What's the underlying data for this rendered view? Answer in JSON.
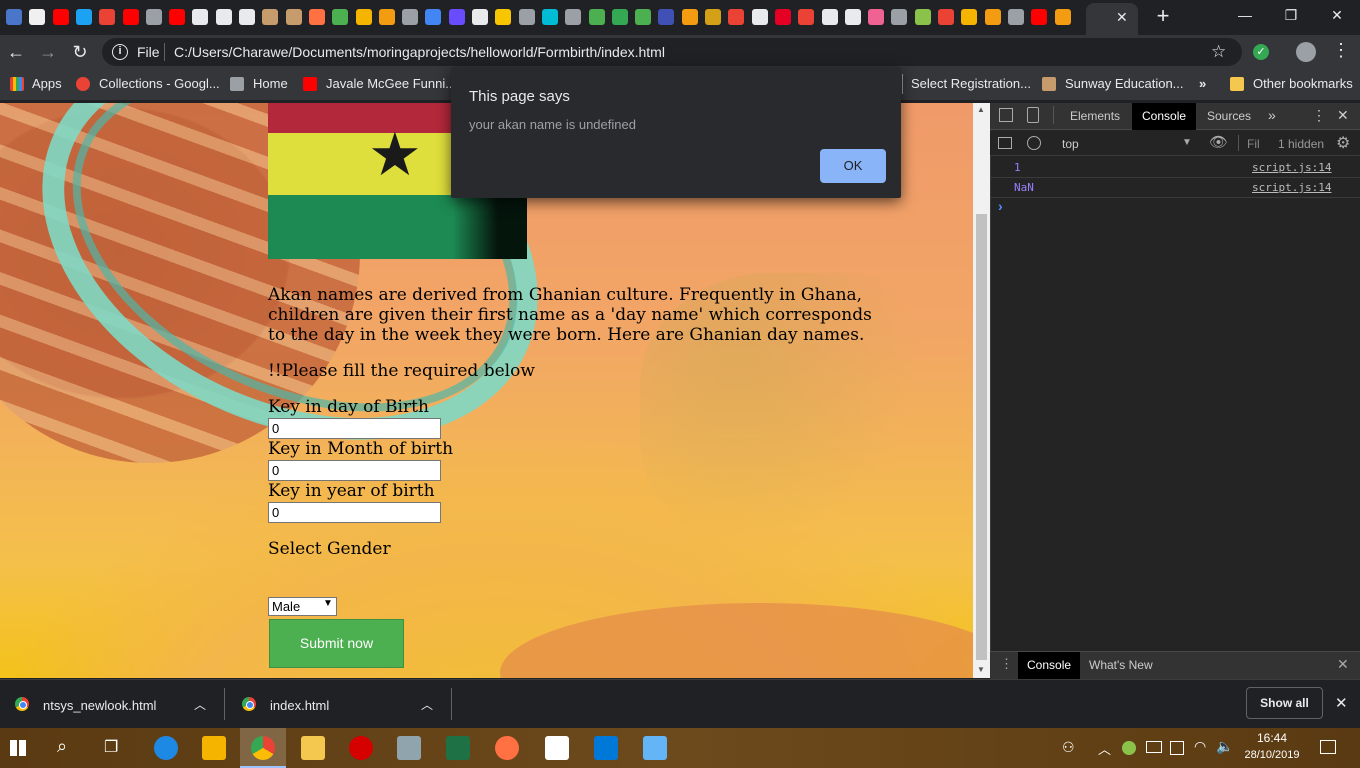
{
  "browser": {
    "omnibox": {
      "scheme_label": "File",
      "url": "C:/Users/Charawe/Documents/moringaprojects/helloworld/Formbirth/index.html"
    },
    "bookmarks": [
      {
        "label": "Apps"
      },
      {
        "label": "Collections - Googl..."
      },
      {
        "label": "Home"
      },
      {
        "label": "Javale McGee Funni..."
      },
      {
        "label": "Select Registration..."
      },
      {
        "label": "Sunway Education..."
      },
      {
        "label": "»"
      },
      {
        "label": "Other bookmarks"
      }
    ],
    "tab_favicon_colors": [
      "#4a76c9",
      "#f0f0f0",
      "#ff0000",
      "#1da1f2",
      "#ea4335",
      "#ff0000",
      "#9aa0a6",
      "#ff0000",
      "#e8eaed",
      "#e8eaed",
      "#e8eaed",
      "#c69c6d",
      "#c69c6d",
      "#ff7043",
      "#4caf50",
      "#f4b400",
      "#f39c12",
      "#9aa0a6",
      "#4285f4",
      "#6a4cff",
      "#e8eaed",
      "#f7c600",
      "#9aa0a6",
      "#00bcd4",
      "#9aa0a6",
      "#4caf50",
      "#34a853",
      "#4caf50",
      "#3f51b5",
      "#f39c12",
      "#d4a017",
      "#ea4335",
      "#e8eaed",
      "#e60023",
      "#ea4335",
      "#e8eaed",
      "#e8eaed",
      "#f06292",
      "#9aa0a6",
      "#8bc34a",
      "#ea4335",
      "#f4b400",
      "#f39c12",
      "#9aa0a6",
      "#ff0000",
      "#f39c12"
    ]
  },
  "page": {
    "intro": "Akan names are derived from Ghanian culture. Frequently in Ghana, children are given their first name as a 'day name' which corresponds to the day in the week they were born. Here are Ghanian day names.",
    "fill_note": "!!Please fill the required below",
    "fields": [
      {
        "label": "Key in day of Birth",
        "value": "0"
      },
      {
        "label": "Key in Month of birth",
        "value": "0"
      },
      {
        "label": "Key in year of birth",
        "value": "0"
      }
    ],
    "gender_label": "Select Gender",
    "gender_selected": "Male",
    "submit_label": "Submit now"
  },
  "alert": {
    "title": "This page says",
    "message": "your akan name is undefined",
    "ok_label": "OK"
  },
  "devtools": {
    "tabs": [
      "Elements",
      "Console",
      "Sources",
      "»"
    ],
    "context": "top",
    "filter_placeholder": "Fil",
    "hidden_count": "1 hidden",
    "logs": [
      {
        "value": "1",
        "source": "script.js:14"
      },
      {
        "value": "NaN",
        "source": "script.js:14"
      }
    ],
    "prompt": "›",
    "drawer_tabs": [
      "Console",
      "What's New"
    ]
  },
  "downloads": {
    "items": [
      {
        "name": "ntsys_newlook.html"
      },
      {
        "name": "index.html"
      }
    ],
    "show_all_label": "Show all"
  },
  "taskbar": {
    "time": "16:44",
    "date": "28/10/2019"
  }
}
